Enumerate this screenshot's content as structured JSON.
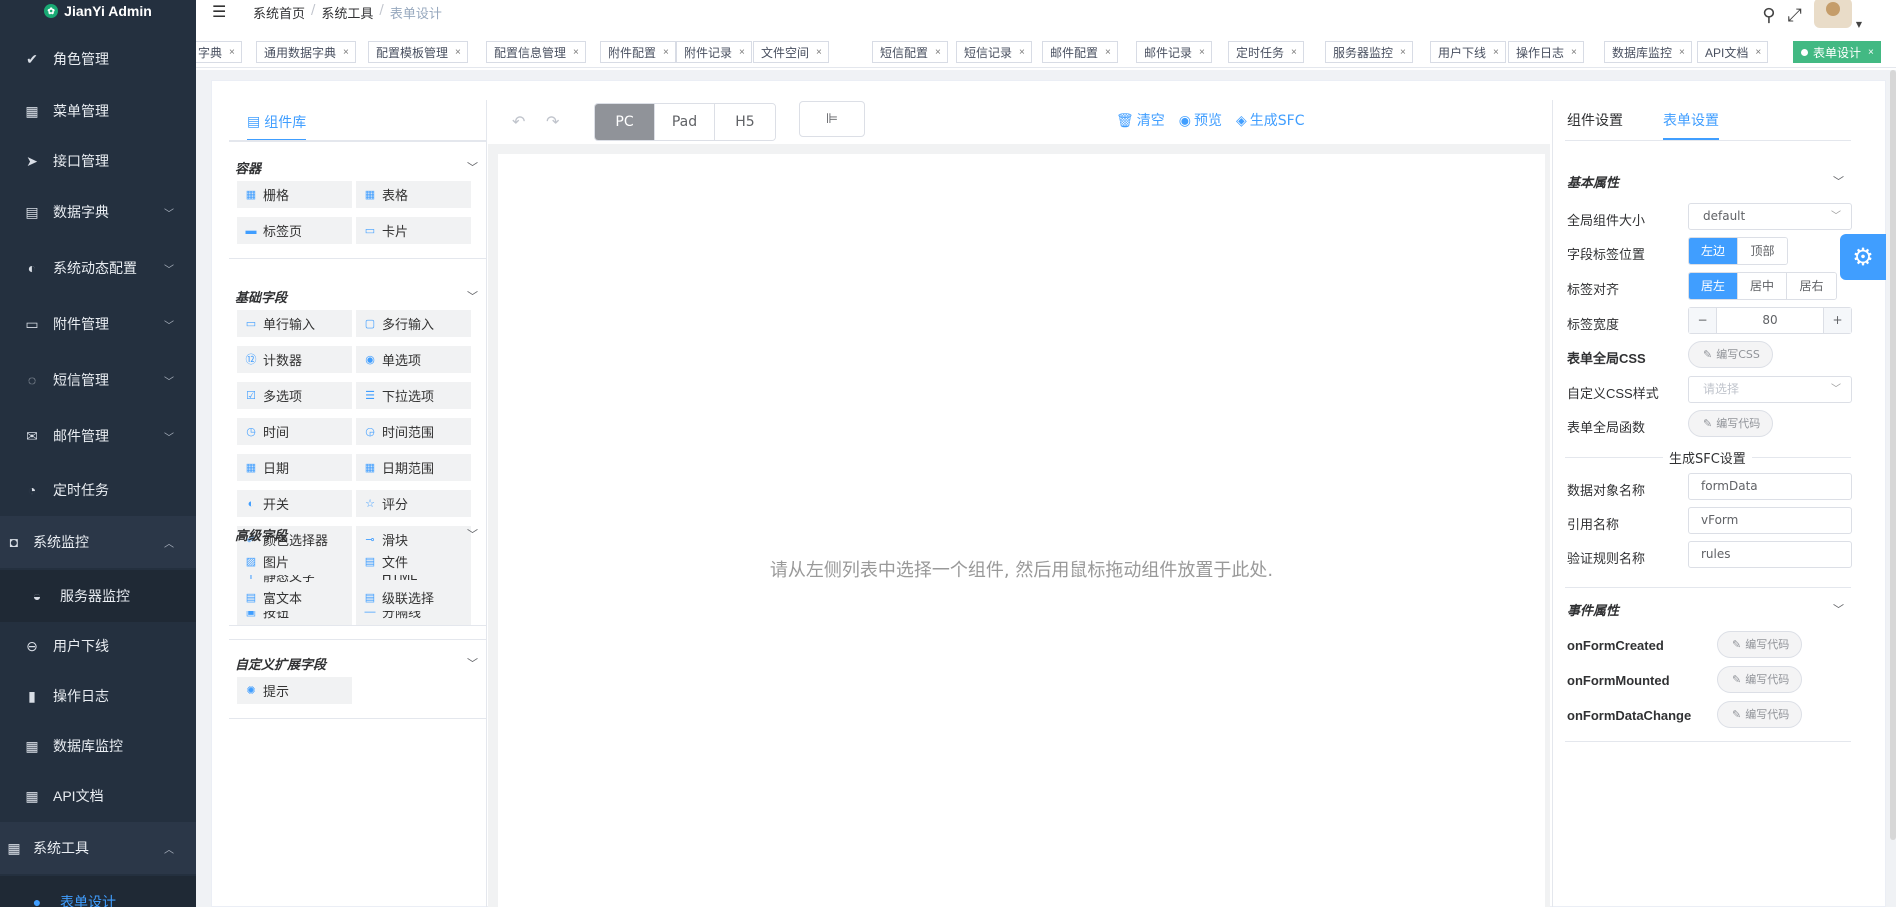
{
  "app": {
    "title": "JianYi Admin",
    "logo_icon": "flower-logo-icon"
  },
  "sidebar": {
    "items": [
      {
        "label": "角色管理",
        "icon": "check-circle-icon",
        "arrow": ""
      },
      {
        "label": "菜单管理",
        "icon": "grid-icon",
        "arrow": ""
      },
      {
        "label": "接口管理",
        "icon": "send-icon",
        "arrow": ""
      },
      {
        "label": "数据字典",
        "icon": "book-icon",
        "arrow": "﹀"
      },
      {
        "label": "系统动态配置",
        "icon": "toggle-icon",
        "arrow": "﹀"
      },
      {
        "label": "附件管理",
        "icon": "folder-icon",
        "arrow": "﹀"
      },
      {
        "label": "短信管理",
        "icon": "chat-icon",
        "arrow": "﹀"
      },
      {
        "label": "邮件管理",
        "icon": "mail-icon",
        "arrow": "﹀"
      },
      {
        "label": "定时任务",
        "icon": "compass-icon",
        "arrow": ""
      },
      {
        "label": "系统监控",
        "icon": "camera-icon",
        "arrow": "︿"
      },
      {
        "label": "服务器监控",
        "icon": "dashboard-icon",
        "arrow": ""
      },
      {
        "label": "用户下线",
        "icon": "minus-circle-icon",
        "arrow": ""
      },
      {
        "label": "操作日志",
        "icon": "bar-chart-icon",
        "arrow": ""
      },
      {
        "label": "数据库监控",
        "icon": "grid-icon",
        "arrow": ""
      },
      {
        "label": "API文档",
        "icon": "grid-icon",
        "arrow": ""
      },
      {
        "label": "系统工具",
        "icon": "apps-icon",
        "arrow": "︿"
      },
      {
        "label": "表单设计",
        "icon": "dot-icon",
        "arrow": ""
      }
    ]
  },
  "header": {
    "breadcrumb": [
      "系统首页",
      "系统工具",
      "表单设计"
    ],
    "icons": [
      "search-icon",
      "fullscreen-icon"
    ]
  },
  "tags": [
    {
      "label": "字典"
    },
    {
      "label": "通用数据字典"
    },
    {
      "label": "配置模板管理"
    },
    {
      "label": "配置信息管理"
    },
    {
      "label": "附件配置"
    },
    {
      "label": "附件记录"
    },
    {
      "label": "文件空间"
    },
    {
      "label": "短信配置"
    },
    {
      "label": "短信记录"
    },
    {
      "label": "邮件配置"
    },
    {
      "label": "邮件记录"
    },
    {
      "label": "定时任务"
    },
    {
      "label": "服务器监控"
    },
    {
      "label": "用户下线"
    },
    {
      "label": "操作日志"
    },
    {
      "label": "数据库监控"
    },
    {
      "label": "API文档"
    },
    {
      "label": "表单设计"
    }
  ],
  "left_panel": {
    "tab": "组件库",
    "sections": [
      {
        "title": "容器",
        "items": [
          "栅格",
          "表格",
          "标签页",
          "卡片"
        ]
      },
      {
        "title": "基础字段",
        "items": [
          "单行输入",
          "多行输入",
          "计数器",
          "单选项",
          "多选项",
          "下拉选项",
          "时间",
          "时间范围",
          "日期",
          "日期范围",
          "开关",
          "评分",
          "颜色选择器",
          "滑块",
          "静态文字",
          "HTML",
          "按钮",
          "分隔线"
        ]
      },
      {
        "title": "高级字段",
        "items": [
          "图片",
          "文件",
          "富文本",
          "级联选择"
        ]
      },
      {
        "title": "自定义扩展字段",
        "items": [
          "提示"
        ]
      }
    ]
  },
  "toolbar": {
    "devices": [
      "PC",
      "Pad",
      "H5"
    ],
    "active_device": "PC",
    "actions": [
      "清空",
      "预览",
      "生成SFC"
    ]
  },
  "canvas": {
    "hint": "请从左侧列表中选择一个组件, 然后用鼠标拖动组件放置于此处."
  },
  "right_panel": {
    "tabs": [
      "组件设置",
      "表单设置"
    ],
    "active_tab": "表单设置",
    "basic_title": "基本属性",
    "labels": {
      "size": "全局组件大小",
      "label_pos": "字段标签位置",
      "label_align": "标签对齐",
      "label_width": "标签宽度",
      "form_css": "表单全局CSS",
      "custom_css": "自定义CSS样式",
      "form_func": "表单全局函数",
      "data_obj": "数据对象名称",
      "ref_name": "引用名称",
      "rules_name": "验证规则名称"
    },
    "size_value": "default",
    "label_pos_options": [
      "左边",
      "顶部"
    ],
    "label_pos_active": "左边",
    "label_align_options": [
      "居左",
      "居中",
      "居右"
    ],
    "label_align_active": "居左",
    "label_width": "80",
    "edit_css": "编写CSS",
    "custom_css_placeholder": "请选择",
    "edit_code": "编写代码",
    "sfc_divider": "生成SFC设置",
    "data_obj_value": "formData",
    "ref_value": "vForm",
    "rules_value": "rules",
    "event_title": "事件属性",
    "events": [
      "onFormCreated",
      "onFormMounted",
      "onFormDataChange"
    ]
  }
}
